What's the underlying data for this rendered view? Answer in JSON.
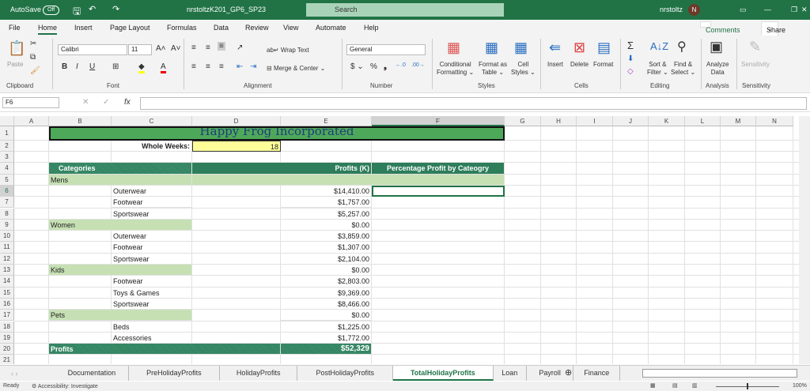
{
  "titlebar": {
    "autosave": "AutoSave",
    "autosave_state": "Off",
    "filename": "nrstoltzK201_GP6_SP23",
    "search": "Search",
    "user": "nrstoltz",
    "avatar": "N"
  },
  "tabs": [
    "File",
    "Home",
    "Insert",
    "Page Layout",
    "Formulas",
    "Data",
    "Review",
    "View",
    "Automate",
    "Help"
  ],
  "actions": {
    "comments": "Comments",
    "share": "Share"
  },
  "ribbon": {
    "paste": "Paste",
    "font": "Calibri",
    "size": "11",
    "wrap": "Wrap Text",
    "merge": "Merge & Center",
    "numfmt": "General",
    "cond1": "Conditional",
    "cond2": "Formatting",
    "fmt1": "Format as",
    "fmt2": "Table",
    "cs1": "Cell",
    "cs2": "Styles",
    "insert": "Insert",
    "delete": "Delete",
    "format": "Format",
    "sort1": "Sort &",
    "sort2": "Filter",
    "find1": "Find &",
    "find2": "Select",
    "an1": "Analyze",
    "an2": "Data",
    "sens": "Sensitivity",
    "groups": [
      "Clipboard",
      "Font",
      "Alignment",
      "Number",
      "Styles",
      "Cells",
      "Editing",
      "Analysis",
      "Sensitivity"
    ]
  },
  "formula": {
    "namebox": "F6",
    "value": ""
  },
  "columns": [
    "A",
    "B",
    "C",
    "D",
    "E",
    "F",
    "G",
    "H",
    "I",
    "J",
    "K",
    "L",
    "M",
    "N"
  ],
  "sheet": {
    "title": "Happy Frog Incorporated",
    "weeks_label": "Whole Weeks:",
    "weeks": "18",
    "h_cat": "Categories",
    "h_profit": "Profits (K)",
    "h_pct": "Percentage Profit by Cateogry",
    "rows": [
      {
        "r": "5",
        "group": "Mens"
      },
      {
        "r": "6",
        "item": "Outerwear",
        "v": "$14,410.00"
      },
      {
        "r": "7",
        "item": "Footwear",
        "v": "$1,757.00"
      },
      {
        "r": "8",
        "item": "Sportswear",
        "v": "$5,257.00"
      },
      {
        "r": "9",
        "group": "Women",
        "v": "$0.00"
      },
      {
        "r": "10",
        "item": "Outerwear",
        "v": "$3,859.00"
      },
      {
        "r": "11",
        "item": "Footwear",
        "v": "$1,307.00"
      },
      {
        "r": "12",
        "item": "Sportswear",
        "v": "$2,104.00"
      },
      {
        "r": "13",
        "group": "Kids",
        "v": "$0.00"
      },
      {
        "r": "14",
        "item": "Footwear",
        "v": "$2,803.00"
      },
      {
        "r": "15",
        "item": "Toys & Games",
        "v": "$9,369.00"
      },
      {
        "r": "16",
        "item": "Sportswear",
        "v": "$8,466.00"
      },
      {
        "r": "17",
        "group": "Pets",
        "v": "$0.00"
      },
      {
        "r": "18",
        "item": "Beds",
        "v": "$1,225.00"
      },
      {
        "r": "19",
        "item": "Accessories",
        "v": "$1,772.00"
      }
    ],
    "total_label": "Profits",
    "total": "$52,329"
  },
  "sheets": [
    "Documentation",
    "PreHolidayProfits",
    "HolidayProfits",
    "PostHolidayProfits",
    "TotalHolidayProfits",
    "Loan",
    "Payroll",
    "Finance"
  ],
  "active_sheet": "TotalHolidayProfits",
  "status": {
    "ready": "Ready",
    "accessibility": "Accessibility: Investigate",
    "zoom": "100%"
  }
}
